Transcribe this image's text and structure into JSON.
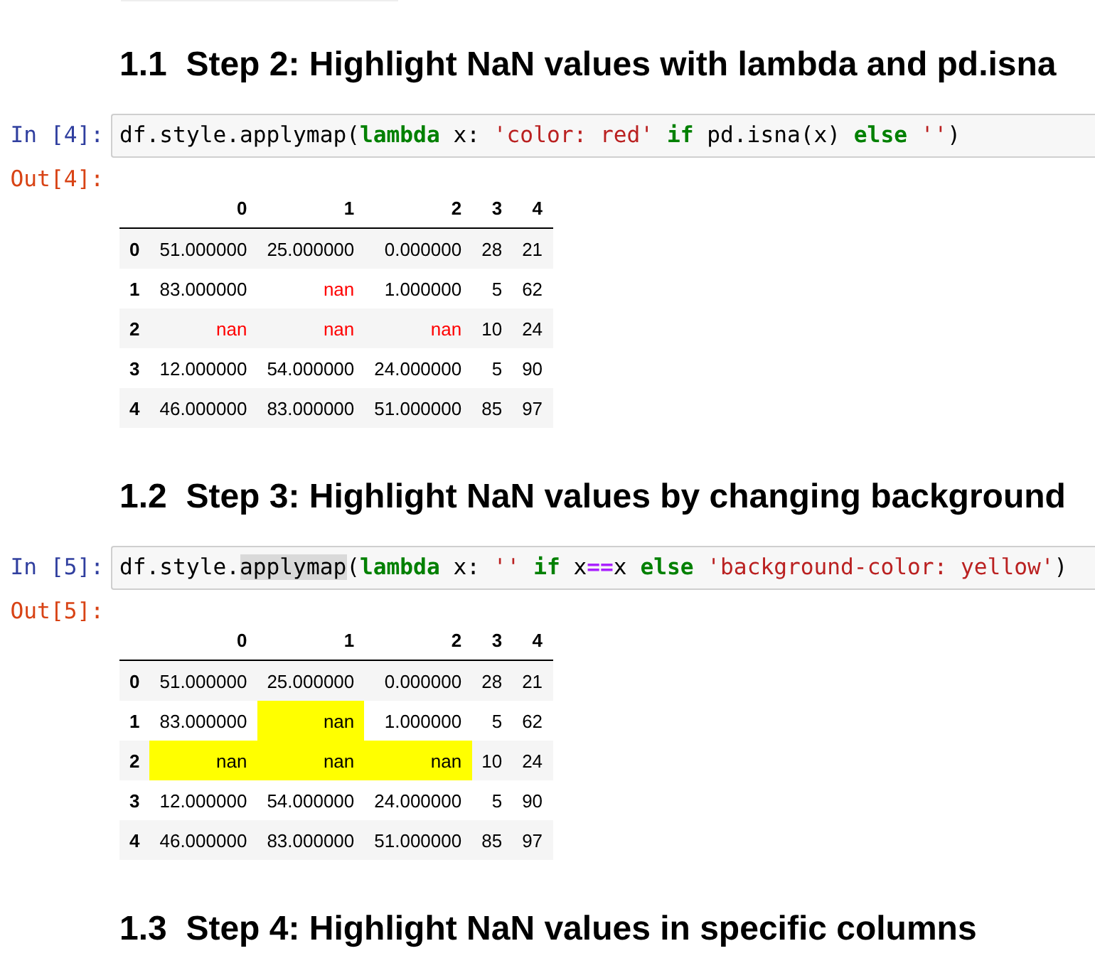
{
  "cells": [
    {
      "kind": "heading",
      "text": "1.1  Step 2: Highlight NaN values with lambda and pd.isna"
    },
    {
      "kind": "code",
      "prompt": "In [4]:",
      "code": [
        {
          "text": "df.style.applymap(",
          "kind": "name",
          "highlighted": false
        },
        {
          "text": "lambda",
          "kind": "keyword",
          "highlighted": false
        },
        {
          "text": " x: ",
          "kind": "name",
          "highlighted": false
        },
        {
          "text": "'color: red' ",
          "kind": "string",
          "highlighted": false
        },
        {
          "text": "if",
          "kind": "keyword",
          "highlighted": false
        },
        {
          "text": " pd.isna(x) ",
          "kind": "name",
          "highlighted": false
        },
        {
          "text": "else",
          "kind": "keyword",
          "highlighted": false
        },
        {
          "text": " ''",
          "kind": "string",
          "highlighted": false
        },
        {
          "text": ")",
          "kind": "name",
          "highlighted": false
        }
      ],
      "output_prompt": "Out[4]:",
      "table": {
        "kind": "textcolor",
        "columns": [
          "0",
          "1",
          "2",
          "3",
          "4"
        ],
        "rows": [
          {
            "index": "0",
            "cells": [
              {
                "text": "51.000000",
                "highlighted": false
              },
              {
                "text": "25.000000",
                "highlighted": false
              },
              {
                "text": "0.000000",
                "highlighted": false
              },
              {
                "text": "28",
                "highlighted": false
              },
              {
                "text": "21",
                "highlighted": false
              }
            ]
          },
          {
            "index": "1",
            "cells": [
              {
                "text": "83.000000",
                "highlighted": false
              },
              {
                "text": "nan",
                "highlighted": true
              },
              {
                "text": "1.000000",
                "highlighted": false
              },
              {
                "text": "5",
                "highlighted": false
              },
              {
                "text": "62",
                "highlighted": false
              }
            ]
          },
          {
            "index": "2",
            "cells": [
              {
                "text": "nan",
                "highlighted": true
              },
              {
                "text": "nan",
                "highlighted": true
              },
              {
                "text": "nan",
                "highlighted": true
              },
              {
                "text": "10",
                "highlighted": false
              },
              {
                "text": "24",
                "highlighted": false
              }
            ]
          },
          {
            "index": "3",
            "cells": [
              {
                "text": "12.000000",
                "highlighted": false
              },
              {
                "text": "54.000000",
                "highlighted": false
              },
              {
                "text": "24.000000",
                "highlighted": false
              },
              {
                "text": "5",
                "highlighted": false
              },
              {
                "text": "90",
                "highlighted": false
              }
            ]
          },
          {
            "index": "4",
            "cells": [
              {
                "text": "46.000000",
                "highlighted": false
              },
              {
                "text": "83.000000",
                "highlighted": false
              },
              {
                "text": "51.000000",
                "highlighted": false
              },
              {
                "text": "85",
                "highlighted": false
              },
              {
                "text": "97",
                "highlighted": false
              }
            ]
          }
        ]
      }
    },
    {
      "kind": "heading",
      "text": "1.2  Step 3: Highlight NaN values by changing background"
    },
    {
      "kind": "code",
      "prompt": "In [5]:",
      "code": [
        {
          "text": "df.style.",
          "kind": "name",
          "highlighted": false
        },
        {
          "text": "applymap",
          "kind": "name",
          "highlighted": true
        },
        {
          "text": "(",
          "kind": "name",
          "highlighted": false
        },
        {
          "text": "lambda",
          "kind": "keyword",
          "highlighted": false
        },
        {
          "text": " x: ",
          "kind": "name",
          "highlighted": false
        },
        {
          "text": "'' ",
          "kind": "string",
          "highlighted": false
        },
        {
          "text": "if",
          "kind": "keyword",
          "highlighted": false
        },
        {
          "text": " x",
          "kind": "name",
          "highlighted": false
        },
        {
          "text": "==",
          "kind": "operator",
          "highlighted": false
        },
        {
          "text": "x ",
          "kind": "name",
          "highlighted": false
        },
        {
          "text": "else",
          "kind": "keyword",
          "highlighted": false
        },
        {
          "text": " 'background-color: yellow'",
          "kind": "string",
          "highlighted": false
        },
        {
          "text": ")",
          "kind": "name",
          "highlighted": false
        }
      ],
      "output_prompt": "Out[5]:",
      "table": {
        "kind": "background",
        "columns": [
          "0",
          "1",
          "2",
          "3",
          "4"
        ],
        "rows": [
          {
            "index": "0",
            "cells": [
              {
                "text": "51.000000",
                "highlighted": false
              },
              {
                "text": "25.000000",
                "highlighted": false
              },
              {
                "text": "0.000000",
                "highlighted": false
              },
              {
                "text": "28",
                "highlighted": false
              },
              {
                "text": "21",
                "highlighted": false
              }
            ]
          },
          {
            "index": "1",
            "cells": [
              {
                "text": "83.000000",
                "highlighted": false
              },
              {
                "text": "nan",
                "highlighted": true
              },
              {
                "text": "1.000000",
                "highlighted": false
              },
              {
                "text": "5",
                "highlighted": false
              },
              {
                "text": "62",
                "highlighted": false
              }
            ]
          },
          {
            "index": "2",
            "cells": [
              {
                "text": "nan",
                "highlighted": true
              },
              {
                "text": "nan",
                "highlighted": true
              },
              {
                "text": "nan",
                "highlighted": true
              },
              {
                "text": "10",
                "highlighted": false
              },
              {
                "text": "24",
                "highlighted": false
              }
            ]
          },
          {
            "index": "3",
            "cells": [
              {
                "text": "12.000000",
                "highlighted": false
              },
              {
                "text": "54.000000",
                "highlighted": false
              },
              {
                "text": "24.000000",
                "highlighted": false
              },
              {
                "text": "5",
                "highlighted": false
              },
              {
                "text": "90",
                "highlighted": false
              }
            ]
          },
          {
            "index": "4",
            "cells": [
              {
                "text": "46.000000",
                "highlighted": false
              },
              {
                "text": "83.000000",
                "highlighted": false
              },
              {
                "text": "51.000000",
                "highlighted": false
              },
              {
                "text": "85",
                "highlighted": false
              },
              {
                "text": "97",
                "highlighted": false
              }
            ]
          }
        ]
      }
    },
    {
      "kind": "heading",
      "text": "1.3  Step 4: Highlight NaN values in specific columns"
    }
  ]
}
